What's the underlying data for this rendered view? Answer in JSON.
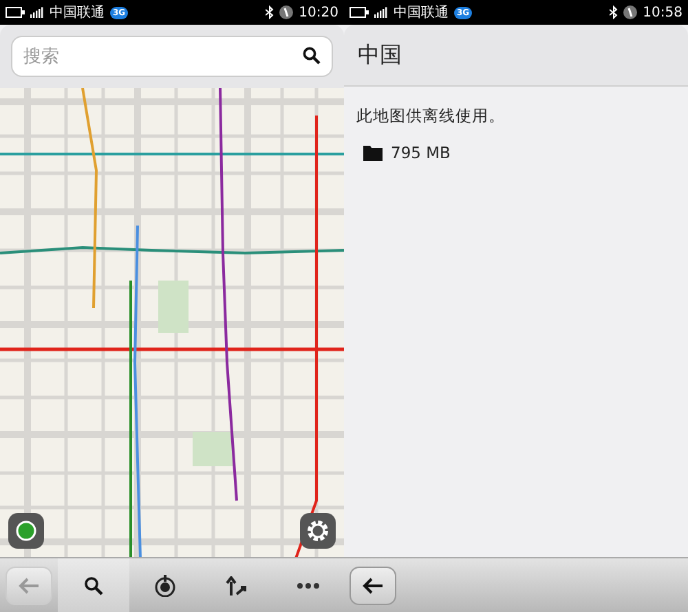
{
  "screens": [
    {
      "status_bar": {
        "carrier": "中国联通",
        "network": "3G",
        "time": "10:20"
      },
      "search": {
        "placeholder": "搜索"
      },
      "toolbar": {
        "back_disabled": true,
        "tools": [
          {
            "kind": "search",
            "selected": true
          },
          {
            "kind": "compass",
            "selected": false
          },
          {
            "kind": "route",
            "selected": false
          },
          {
            "kind": "more",
            "selected": false
          }
        ]
      }
    },
    {
      "status_bar": {
        "carrier": "中国联通",
        "network": "3G",
        "time": "10:58"
      },
      "header": {
        "title": "中国"
      },
      "body": {
        "message": "此地图供离线使用。",
        "size": "795 MB"
      },
      "toolbar": {
        "back_disabled": false
      }
    }
  ]
}
